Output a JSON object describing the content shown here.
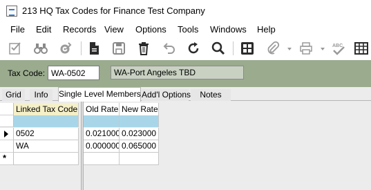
{
  "window": {
    "title": "213 HQ Tax Codes for Finance Test Company"
  },
  "menu": [
    "File",
    "Edit",
    "Records",
    "View",
    "Options",
    "Tools",
    "Windows",
    "Help"
  ],
  "header": {
    "tax_code_label": "Tax Code:",
    "tax_code_value": "WA-0502",
    "description": "WA-Port Angeles TBD"
  },
  "tabs": [
    "Grid",
    "Info",
    "Single Level Members",
    "Add'l Options",
    "Notes"
  ],
  "active_tab": "Single Level Members",
  "left_grid": {
    "column": "Linked Tax Code",
    "rows": [
      "0502",
      "WA"
    ]
  },
  "right_grid": {
    "columns": [
      "Old Rate",
      "New Rate"
    ],
    "rows": [
      [
        "0.021000",
        "0.023000"
      ],
      [
        "0.000000",
        "0.065000"
      ]
    ]
  },
  "colors": {
    "header_panel": "#9aab8e",
    "filter_row": "#a8d6e8",
    "linked_header": "#f5f0c8"
  },
  "toolbar_icons": [
    "checklist-icon",
    "binoculars-icon",
    "settings-gear-icon",
    "document-icon",
    "save-icon",
    "delete-icon",
    "undo-icon",
    "refresh-icon",
    "search-icon",
    "calculator-icon",
    "attachment-icon",
    "print-icon",
    "spellcheck-icon",
    "grid-view-icon"
  ]
}
